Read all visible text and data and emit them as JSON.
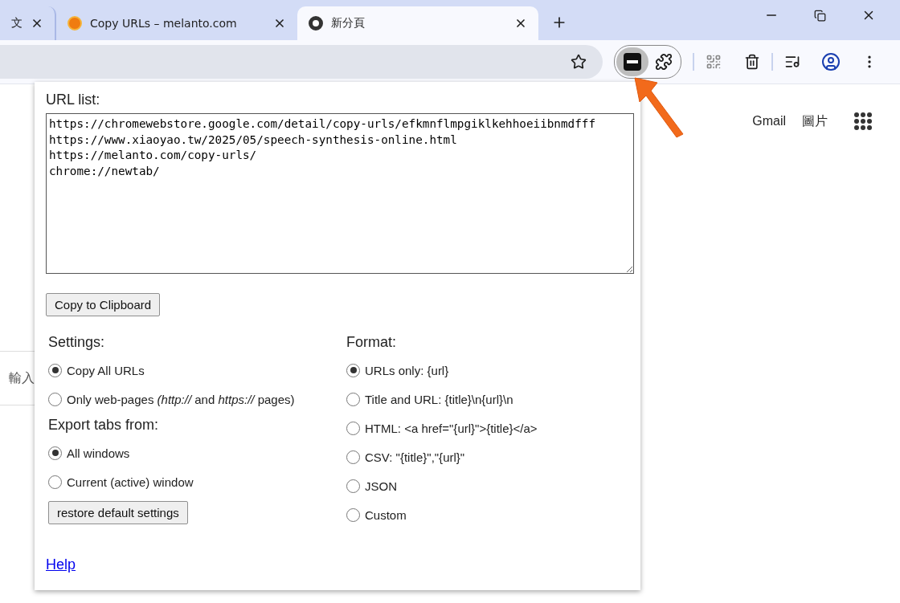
{
  "tabs": [
    {
      "title": "文",
      "selected": false,
      "kind": "cut"
    },
    {
      "title": "Copy URLs – melanto.com",
      "selected": false,
      "kind": "site"
    },
    {
      "title": "新分頁",
      "selected": true,
      "kind": "chrome"
    }
  ],
  "page": {
    "search_fragment": "輸入",
    "links": [
      "Gmail",
      "圖片"
    ]
  },
  "popup": {
    "url_list_label": "URL list:",
    "url_list": "https://chromewebstore.google.com/detail/copy-urls/efkmnflmpgiklkehhoeiibnmdfff\nhttps://www.xiaoyao.tw/2025/05/speech-synthesis-online.html\nhttps://melanto.com/copy-urls/\nchrome://newtab/",
    "copy_button": "Copy to Clipboard",
    "settings": {
      "heading": "Settings:",
      "options": [
        {
          "label": "Copy All URLs",
          "selected": true
        },
        {
          "label": "Only web-pages *(http://* and *https://* pages)",
          "selected": false
        }
      ]
    },
    "export": {
      "heading": "Export tabs from:",
      "options": [
        {
          "label": "All windows",
          "selected": true
        },
        {
          "label": "Current (active) window",
          "selected": false
        }
      ]
    },
    "restore_button": "restore default settings",
    "format": {
      "heading": "Format:",
      "options": [
        {
          "label": "URLs only: {url}",
          "selected": true
        },
        {
          "label": "Title and URL: {title}\\n{url}\\n",
          "selected": false
        },
        {
          "label": "HTML: <a href=\"{url}\">{title}</a>",
          "selected": false
        },
        {
          "label": "CSV: \"{title}\",\"{url}\"",
          "selected": false
        },
        {
          "label": "JSON",
          "selected": false
        },
        {
          "label": "Custom",
          "selected": false
        }
      ]
    },
    "help_link": "Help"
  }
}
